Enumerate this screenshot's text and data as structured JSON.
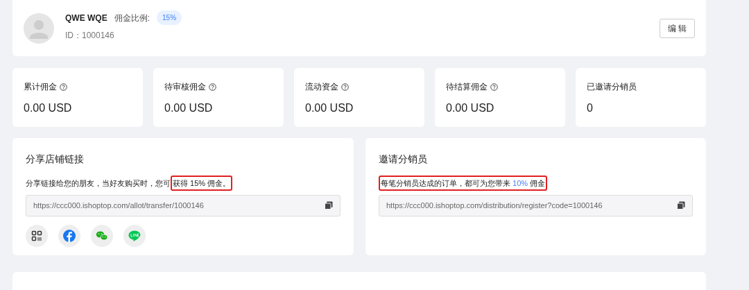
{
  "profile": {
    "name": "QWE WQE",
    "rate_label": "佣金比例:",
    "rate": "15%",
    "id": "ID：1000146",
    "edit_button": "编 辑"
  },
  "stats": [
    {
      "label": "累计佣金",
      "help": true,
      "value": "0.00 USD"
    },
    {
      "label": "待审核佣金",
      "help": true,
      "value": "0.00 USD"
    },
    {
      "label": "流动资金",
      "help": true,
      "value": "0.00 USD"
    },
    {
      "label": "待结算佣金",
      "help": true,
      "value": "0.00 USD"
    },
    {
      "label": "已邀请分销员",
      "help": false,
      "value": "0"
    }
  ],
  "panels": [
    {
      "title": "分享店铺链接",
      "description": [
        {
          "text": "分享链接给您的朋友，当好友购买时，您可",
          "highlighted": false,
          "accent": false
        },
        {
          "text": "获得 15% 佣金。",
          "highlighted": true,
          "accent": false
        }
      ],
      "link": "https://ccc000.ishoptop.com/allot/transfer/1000146",
      "share": [
        {
          "kind": "qrcode"
        },
        {
          "kind": "facebook"
        },
        {
          "kind": "wechat"
        },
        {
          "kind": "line"
        }
      ]
    },
    {
      "title": "邀请分销员",
      "description": [
        {
          "text": "每笔分销员达成的订单，都可为您带来 ",
          "highlighted": true,
          "accent": false
        },
        {
          "text": "10%",
          "highlighted": true,
          "accent": true
        },
        {
          "text": " 佣金",
          "highlighted": true,
          "accent": false
        }
      ],
      "link": "https://ccc000.ishoptop.com/distribution/register?code=1000146"
    }
  ]
}
